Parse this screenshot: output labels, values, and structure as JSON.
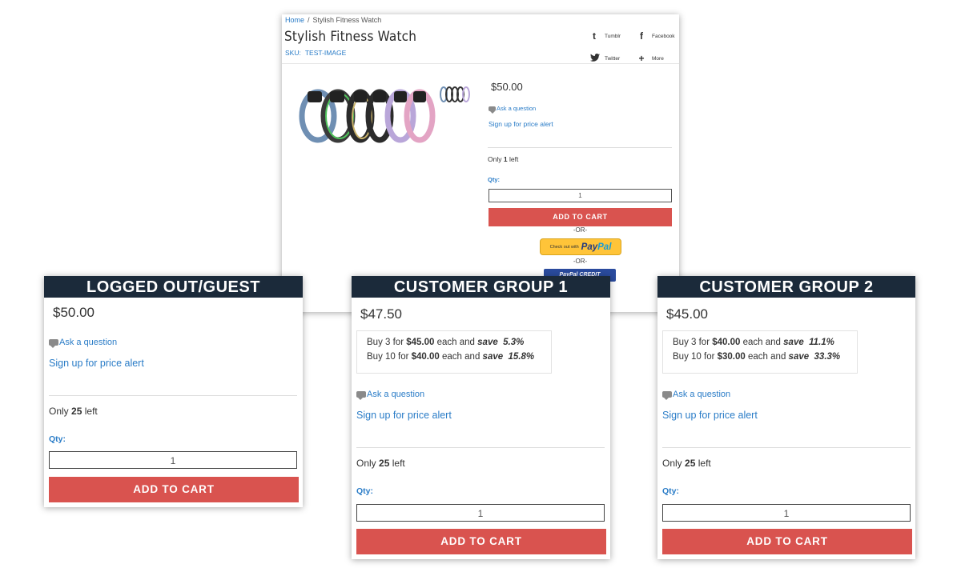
{
  "product": {
    "breadcrumb_home": "Home",
    "breadcrumb_sep": "/",
    "breadcrumb_current": "Stylish Fitness Watch",
    "title": "Stylish Fitness Watch",
    "sku_label": "SKU:",
    "sku_value": "TEST-IMAGE",
    "share": [
      "Tumblr",
      "Facebook",
      "Twitter",
      "More"
    ],
    "price": "$50.00",
    "ask_question": "Ask a question",
    "price_alert": "Sign up for price alert",
    "only_prefix": "Only",
    "only_count": "1",
    "only_suffix": "left",
    "qty_label": "Qty:",
    "qty_value": "1",
    "add_to_cart": "ADD TO CART",
    "or_label": "-OR-",
    "paypal_checkout": "Check out with",
    "paypal_brand_1": "Pay",
    "paypal_brand_2": "Pal",
    "paypal_credit": "PayPal CREDIT"
  },
  "groups": [
    {
      "header": "LOGGED OUT/GUEST",
      "price": "$50.00",
      "ask_question": "Ask a question",
      "price_alert": "Sign up for price alert",
      "only_prefix": "Only",
      "only_count": "25",
      "only_suffix": "left",
      "qty_label": "Qty:",
      "qty_value": "1",
      "add_to_cart": "ADD TO CART"
    },
    {
      "header": "CUSTOMER GROUP 1",
      "price": "$47.50",
      "tiers": [
        {
          "buy": "Buy 3 for",
          "price": "$45.00",
          "each": "each and",
          "save": "save",
          "pct": "5.3%"
        },
        {
          "buy": "Buy 10 for",
          "price": "$40.00",
          "each": "each and",
          "save": "save",
          "pct": "15.8%"
        }
      ],
      "ask_question": "Ask a question",
      "price_alert": "Sign up for price alert",
      "only_prefix": "Only",
      "only_count": "25",
      "only_suffix": "left",
      "qty_label": "Qty:",
      "qty_value": "1",
      "add_to_cart": "ADD TO CART"
    },
    {
      "header": "CUSTOMER GROUP 2",
      "price": "$45.00",
      "tiers": [
        {
          "buy": "Buy 3 for",
          "price": "$40.00",
          "each": "each and",
          "save": "save",
          "pct": "11.1%"
        },
        {
          "buy": "Buy 10 for",
          "price": "$30.00",
          "each": "each and",
          "save": "save",
          "pct": "33.3%"
        }
      ],
      "ask_question": "Ask a question",
      "price_alert": "Sign up for price alert",
      "only_prefix": "Only",
      "only_count": "25",
      "only_suffix": "left",
      "qty_label": "Qty:",
      "qty_value": "1",
      "add_to_cart": "ADD TO CART"
    }
  ],
  "colors": {
    "link": "#2a7cc7",
    "cart_button": "#d9534f",
    "panel_header": "#1b2a3a",
    "paypal_yellow": "#ffc439"
  }
}
